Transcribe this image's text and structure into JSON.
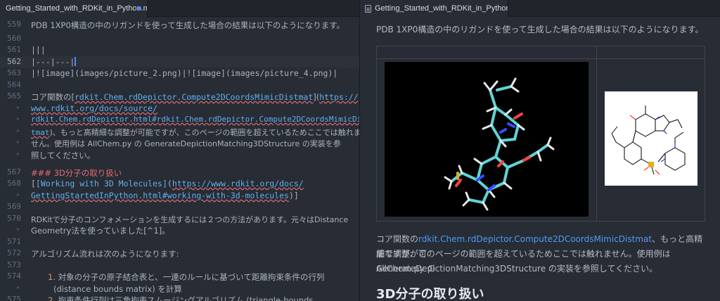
{
  "editor": {
    "tab_title": "Getting_Started_with_RDKit_in_Python.m",
    "line_numbers": [
      "559",
      "560",
      "561",
      "562",
      "563",
      "564",
      "565",
      "",
      "",
      "",
      "",
      "",
      "567",
      "568",
      "",
      "569",
      "570",
      "",
      "571",
      "572",
      "573",
      "574",
      "",
      "575"
    ],
    "lines": {
      "l559": "PDB 1XP0構造の中のリガンドを使って生成した場合の結果は以下のようになります。",
      "l561": "|||",
      "l562": "|---|---|",
      "l563": "|![image](images/picture_2.png)|![image](images/picture_4.png)|",
      "l565a": "コア関数の[",
      "l565b": "rdkit.Chem.rdDepictor.Compute2DCoordsMimicDistmat",
      "l565c": "](",
      "l565d": "https://",
      "l565e": "www.rdkit.org/docs/source/",
      "l565f": "rdkit.Chem.rdDepictor.html#rdkit.Chem.rdDepictor.Compute2DCoordsMimicDis",
      "l565g": "tmat",
      "l565h": ")、もっと高精細な調整が可能ですが、このページの範囲を超えているためここでは触れま",
      "l565i": "せん。使用例は AllChem.py の GenerateDepictionMatching3DStructure の実装を参",
      "l565j": "照してください。",
      "l567": "### 3D分子の取り扱い",
      "l568a": "[",
      "l568b": "[Working with 3D Molecules]",
      "l568c": "(",
      "l568d": "https://www.rdkit.org/docs/",
      "l568e": "GettingStartedInPython.html#working-with-3d-molecules",
      "l568f": ")]",
      "l570a": "RDKitで分子のコンフォメーションを生成するには２つの方法があります。元々はDistance",
      "l570b": "Geometry法を使っていました[^1]。",
      "l572": "アルゴリズム流れは次のようになります:",
      "l574num": "1.",
      "l574a": "対象の分子の原子結合表と、一連のルールに基づいて距離拘束条件の行列",
      "l574b": "(distance bounds matrix) を計算",
      "l575num": "2.",
      "l575a": "拘束条件行列は三角拘束スムージングアルゴリズム (triangle-bounds"
    }
  },
  "preview": {
    "tab_title": "Getting_Started_with_RDKit_in_Python.m",
    "p1": "PDB 1XP0構造の中のリガンドを使って生成した場合の結果は以下のようになります。",
    "p2_before": "コア関数の",
    "p2_link": "rdkit.Chem.rdDepictor.Compute2DCoordsMimicDistmat",
    "p2_after1": "、もっと高精細な調整が可",
    "p2_line2": "能ですが、このページの範囲を超えているためここでは触れません。使用例は AllChem.py の",
    "p2_line3": "GenerateDepictionMatching3DStructure の実装を参照してください。",
    "h3": "3D分子の取り扱い"
  },
  "colors": {
    "background": "#282c34",
    "link": "#4f9bf7",
    "heading_mark": "#e06c75",
    "accent": "#528bff"
  }
}
